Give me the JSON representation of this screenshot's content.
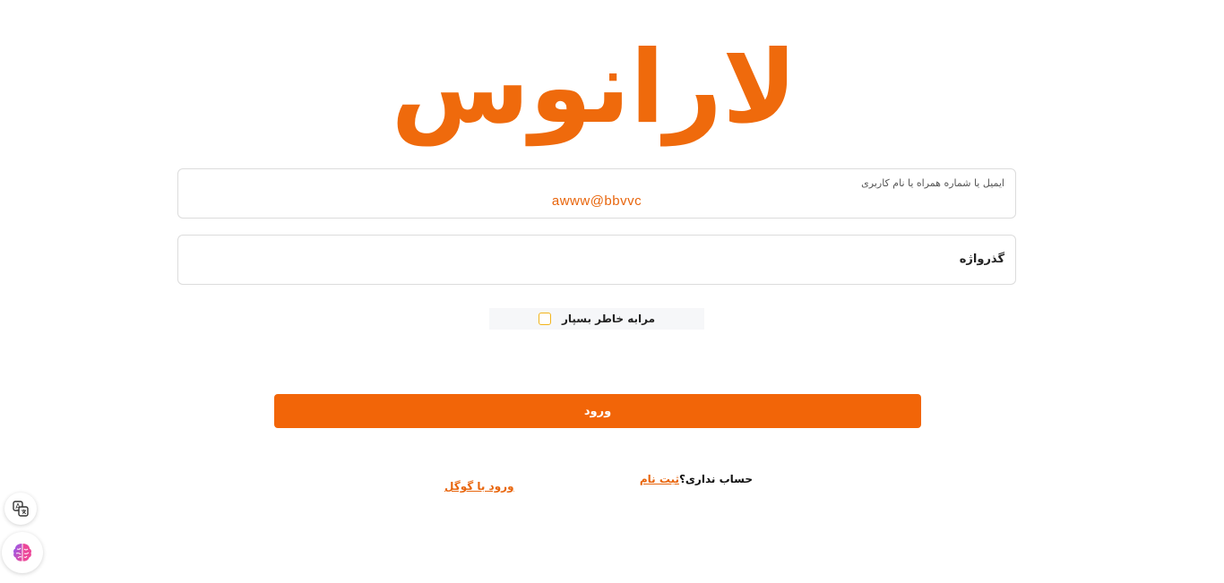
{
  "logo": {
    "text": "لارانوس"
  },
  "form": {
    "identifier": {
      "label": "ایمیل یا شماره همراه یا نام کاربری",
      "value": "awww@bbvvc"
    },
    "password": {
      "label": "گذرواژه"
    },
    "remember_me": {
      "label": "مرابه خاطر بسپار",
      "checked": false
    },
    "submit_label": "ورود"
  },
  "footer": {
    "no_account": "حساب نداری؟",
    "signup_link": "ثبت نام",
    "google_login": "ورود با گوگل"
  },
  "floating": {
    "translate_icon": "translate-icon",
    "brain_icon": "brain-icon"
  },
  "colors": {
    "brand": "#ef6a0c",
    "button": "#f26508",
    "checkbox_border": "#f2b41b"
  }
}
